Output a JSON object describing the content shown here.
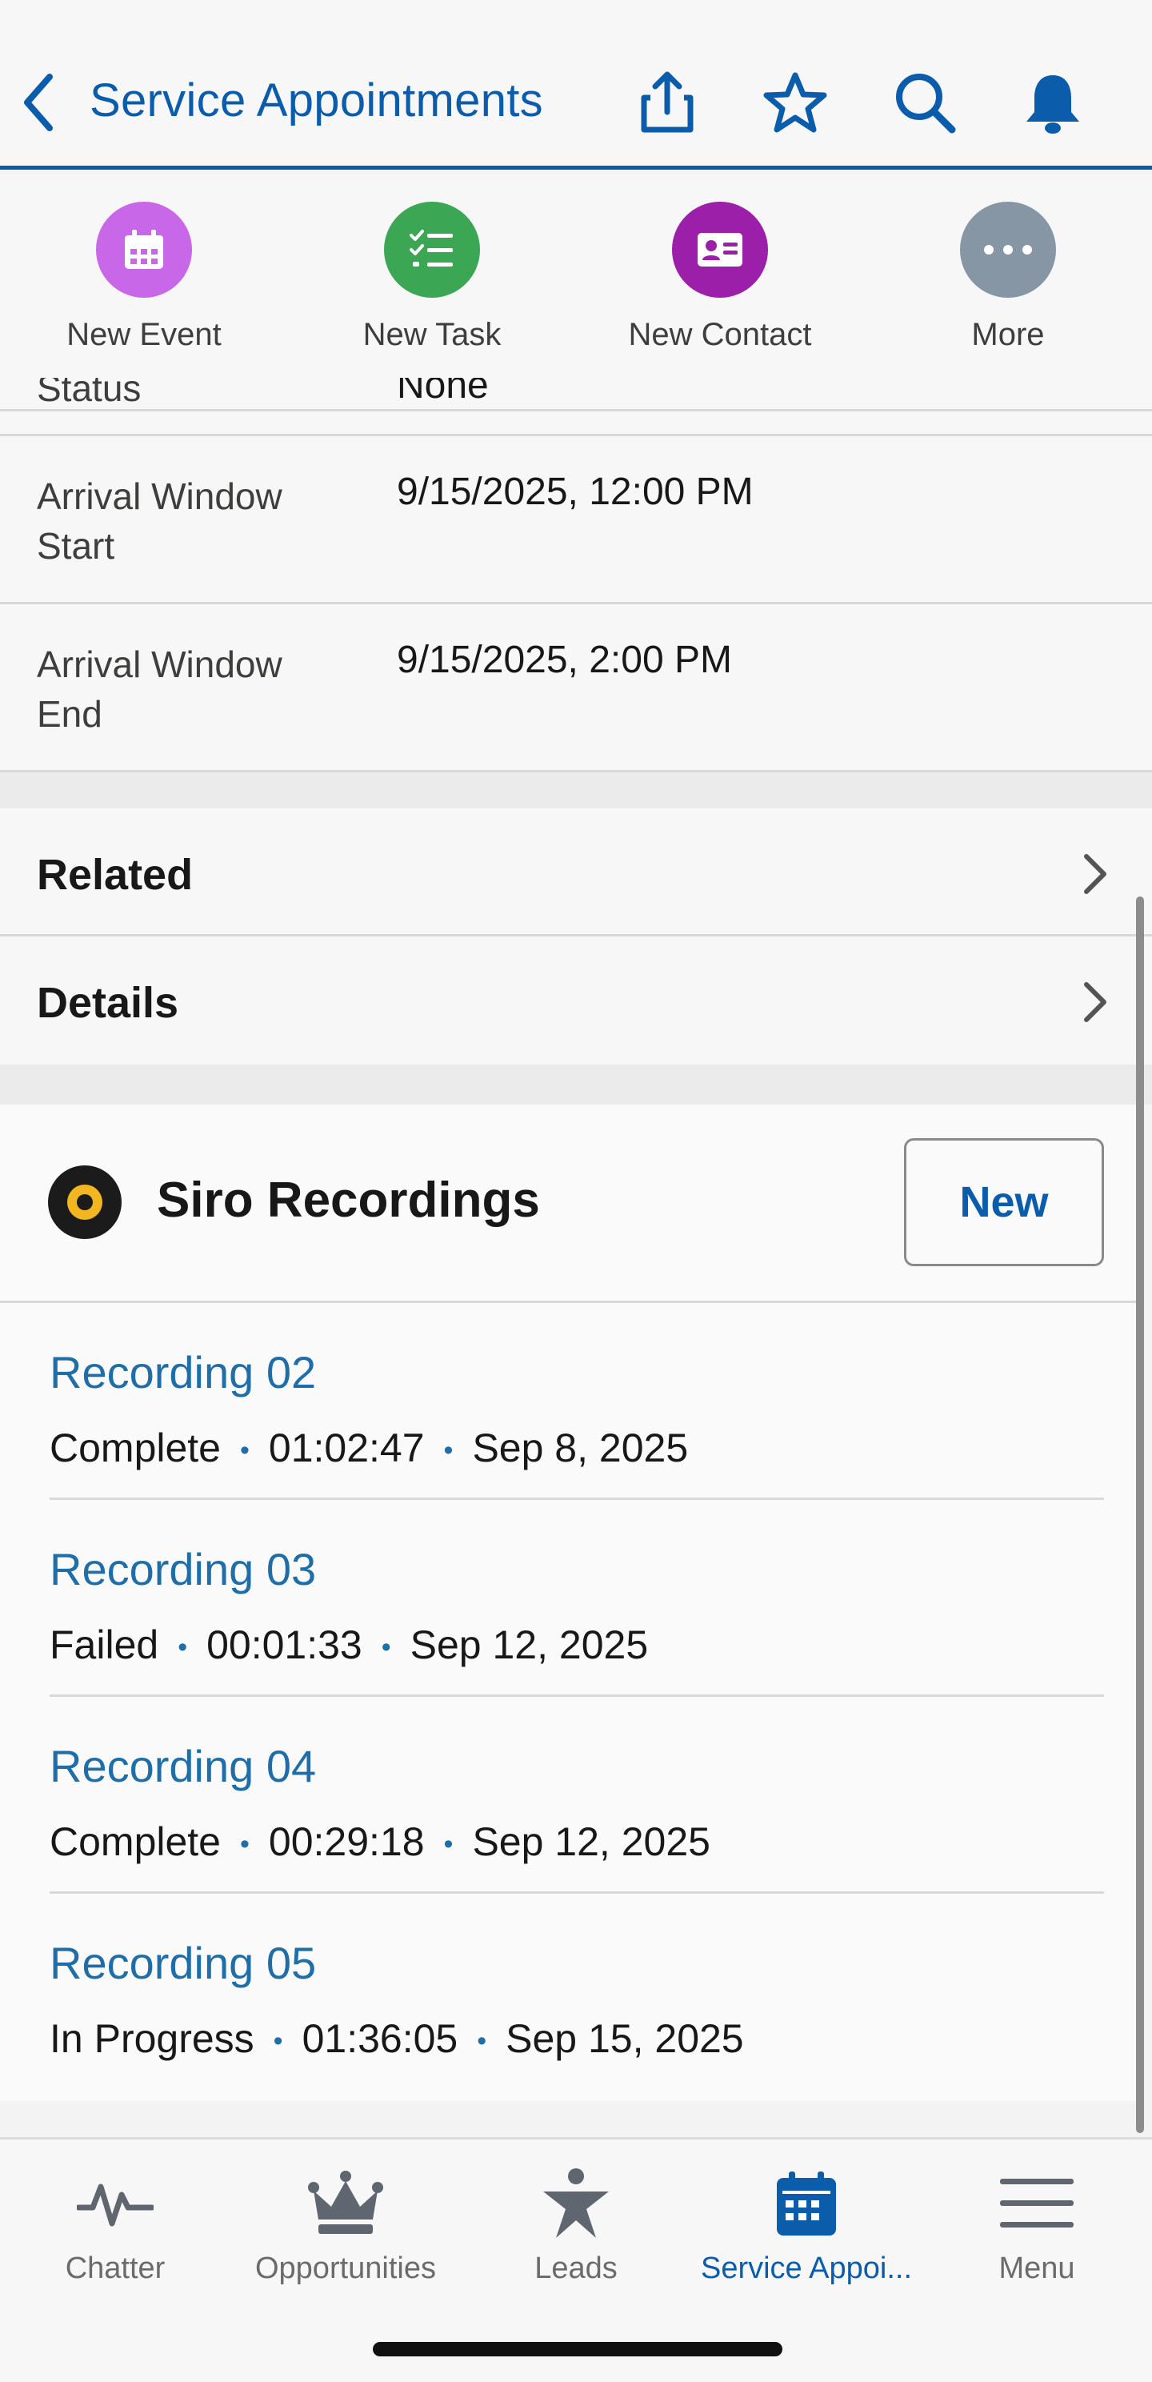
{
  "header": {
    "back_icon": "chevron-left-icon",
    "title": "Service Appointments",
    "actions": [
      "share-icon",
      "star-icon",
      "search-icon",
      "bell-icon"
    ],
    "accent": "#0b5cab"
  },
  "quick_actions": [
    {
      "label": "New Event",
      "icon": "calendar-icon",
      "color": "#c868e8"
    },
    {
      "label": "New Task",
      "icon": "task-list-icon",
      "color": "#3ba755"
    },
    {
      "label": "New Contact",
      "icon": "contact-card-icon",
      "color": "#9b1fa8"
    },
    {
      "label": "More",
      "icon": "more-icon",
      "color": "#8796a5"
    }
  ],
  "fields": {
    "status": {
      "label": "Status",
      "value": "None"
    },
    "arrival_start": {
      "label": "Arrival Window Start",
      "value": "9/15/2025, 12:00 PM"
    },
    "arrival_end": {
      "label": "Arrival Window End",
      "value": "9/15/2025, 2:00 PM"
    }
  },
  "nav": {
    "related": "Related",
    "details": "Details"
  },
  "siro": {
    "title": "Siro Recordings",
    "new_label": "New",
    "recordings": [
      {
        "name": "Recording 02",
        "status": "Complete",
        "duration": "01:02:47",
        "date": "Sep 8, 2025"
      },
      {
        "name": "Recording 03",
        "status": "Failed",
        "duration": "00:01:33",
        "date": "Sep 12, 2025"
      },
      {
        "name": "Recording 04",
        "status": "Complete",
        "duration": "00:29:18",
        "date": "Sep 12, 2025"
      },
      {
        "name": "Recording 05",
        "status": "In Progress",
        "duration": "01:36:05",
        "date": "Sep 15, 2025"
      }
    ]
  },
  "tabbar": [
    {
      "label": "Chatter",
      "icon": "pulse-icon"
    },
    {
      "label": "Opportunities",
      "icon": "crown-icon"
    },
    {
      "label": "Leads",
      "icon": "person-star-icon"
    },
    {
      "label": "Service Appoi...",
      "icon": "calendar-icon",
      "active": true
    },
    {
      "label": "Menu",
      "icon": "hamburger-icon"
    }
  ]
}
